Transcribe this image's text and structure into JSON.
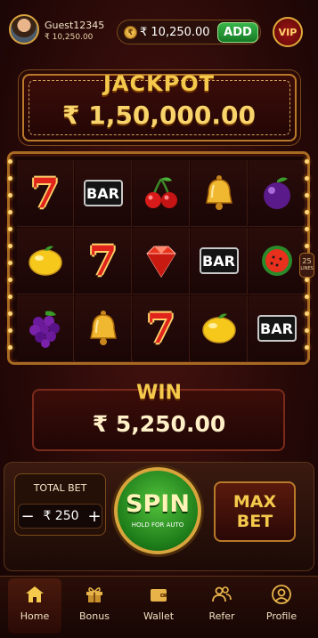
{
  "user": {
    "name": "Guest12345",
    "balance": "₹ 10,250.00"
  },
  "wallet": {
    "balance": "₹ 10,250.00",
    "add_label": "ADD",
    "coin_icon": "rupee-coin-icon"
  },
  "vip": {
    "label": "VIP"
  },
  "jackpot": {
    "title": "JACKPOT",
    "amount": "₹ 1,50,000.00"
  },
  "reels": {
    "rows": [
      [
        "seven",
        "bar",
        "cherry",
        "bell",
        "plum"
      ],
      [
        "lemon",
        "seven",
        "diamond",
        "bar",
        "watermelon"
      ],
      [
        "grapes",
        "bell",
        "seven",
        "lemon",
        "bar"
      ]
    ],
    "bar_text": "BAR",
    "seven_text": "7"
  },
  "side_badge": {
    "line1": "25",
    "line2": "LINES"
  },
  "win": {
    "title": "WIN",
    "amount": "₹ 5,250.00"
  },
  "bet": {
    "label": "TOTAL BET",
    "value": "₹ 250",
    "minus": "−",
    "plus": "+"
  },
  "spin": {
    "label": "SPIN",
    "sub": "HOLD FOR AUTO"
  },
  "max_bet": {
    "line1": "MAX",
    "line2": "BET"
  },
  "nav": [
    {
      "label": "Home",
      "icon": "home-icon",
      "active": true
    },
    {
      "label": "Bonus",
      "icon": "gift-icon",
      "active": false
    },
    {
      "label": "Wallet",
      "icon": "wallet-icon",
      "active": false
    },
    {
      "label": "Refer",
      "icon": "users-icon",
      "active": false
    },
    {
      "label": "Profile",
      "icon": "profile-icon",
      "active": false
    }
  ],
  "colors": {
    "gold": "#f5c94c",
    "accent_green": "#39b54a",
    "background": "#2a0a08"
  }
}
